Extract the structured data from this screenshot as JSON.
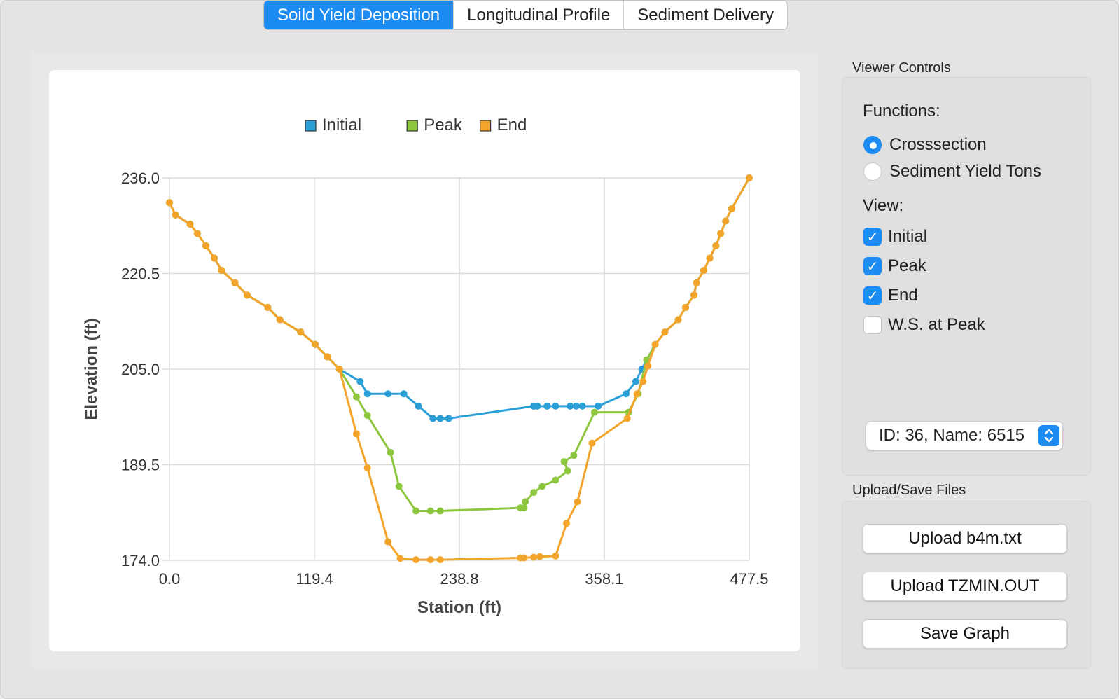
{
  "tabs": [
    {
      "label": "Soild Yield Deposition",
      "active": true
    },
    {
      "label": "Longitudinal Profile",
      "active": false
    },
    {
      "label": "Sediment Delivery",
      "active": false
    }
  ],
  "chart_data": {
    "type": "line",
    "xlabel": "Station (ft)",
    "ylabel": "Elevation (ft)",
    "xlim": [
      0.0,
      477.5
    ],
    "ylim": [
      174.0,
      236.0
    ],
    "xticks": [
      "0.0",
      "119.4",
      "238.8",
      "358.1",
      "477.5"
    ],
    "yticks": [
      "174.0",
      "189.5",
      "205.0",
      "220.5",
      "236.0"
    ],
    "grid": true,
    "legend_position": "top-center",
    "series": [
      {
        "name": "Initial",
        "color": "#2a9fd8",
        "points": [
          [
            0,
            232
          ],
          [
            5,
            230
          ],
          [
            17,
            228.5
          ],
          [
            23,
            227
          ],
          [
            30,
            225
          ],
          [
            37,
            223
          ],
          [
            43,
            221
          ],
          [
            54,
            219
          ],
          [
            64,
            217
          ],
          [
            81,
            215
          ],
          [
            91,
            213
          ],
          [
            108,
            211
          ],
          [
            120,
            209
          ],
          [
            130,
            207
          ],
          [
            140,
            205
          ],
          [
            157,
            203
          ],
          [
            163,
            201
          ],
          [
            180,
            201
          ],
          [
            193,
            201
          ],
          [
            205,
            199
          ],
          [
            217,
            197
          ],
          [
            223,
            197
          ],
          [
            230,
            197
          ],
          [
            300,
            199
          ],
          [
            303,
            199
          ],
          [
            300,
            199
          ],
          [
            311,
            199
          ],
          [
            318,
            199
          ],
          [
            330,
            199
          ],
          [
            335,
            199
          ],
          [
            340,
            199
          ],
          [
            353,
            199
          ],
          [
            376,
            201
          ],
          [
            384,
            203
          ],
          [
            389,
            205
          ],
          [
            393,
            206.5
          ],
          [
            400,
            209
          ],
          [
            408,
            211
          ],
          [
            419,
            213
          ],
          [
            425,
            215
          ],
          [
            432,
            217
          ],
          [
            434,
            219
          ],
          [
            440,
            221
          ],
          [
            445,
            223
          ],
          [
            450,
            225
          ],
          [
            454,
            227
          ],
          [
            458,
            229
          ],
          [
            463,
            231
          ],
          [
            477.5,
            236
          ]
        ]
      },
      {
        "name": "Peak",
        "color": "#8dc63f",
        "points": [
          [
            0,
            232
          ],
          [
            5,
            230
          ],
          [
            17,
            228.5
          ],
          [
            23,
            227
          ],
          [
            30,
            225
          ],
          [
            37,
            223
          ],
          [
            43,
            221
          ],
          [
            54,
            219
          ],
          [
            64,
            217
          ],
          [
            81,
            215
          ],
          [
            91,
            213
          ],
          [
            108,
            211
          ],
          [
            120,
            209
          ],
          [
            130,
            207
          ],
          [
            140,
            205
          ],
          [
            154,
            200.5
          ],
          [
            163,
            197.5
          ],
          [
            182,
            191.5
          ],
          [
            189,
            186
          ],
          [
            203,
            182
          ],
          [
            215,
            182
          ],
          [
            223,
            182
          ],
          [
            289,
            182.5
          ],
          [
            292,
            182.5
          ],
          [
            293,
            183.5
          ],
          [
            300,
            185
          ],
          [
            307,
            186
          ],
          [
            318,
            187
          ],
          [
            328,
            188.5
          ],
          [
            325,
            190
          ],
          [
            333,
            191
          ],
          [
            350,
            198
          ],
          [
            378,
            198
          ],
          [
            386,
            201
          ],
          [
            393,
            206.5
          ],
          [
            400,
            209
          ],
          [
            408,
            211
          ],
          [
            419,
            213
          ],
          [
            425,
            215
          ],
          [
            432,
            217
          ],
          [
            434,
            219
          ],
          [
            440,
            221
          ],
          [
            445,
            223
          ],
          [
            450,
            225
          ],
          [
            454,
            227
          ],
          [
            458,
            229
          ],
          [
            463,
            231
          ],
          [
            477.5,
            236
          ]
        ]
      },
      {
        "name": "End",
        "color": "#f3a42a",
        "points": [
          [
            0,
            232
          ],
          [
            5,
            230
          ],
          [
            17,
            228.5
          ],
          [
            23,
            227
          ],
          [
            30,
            225
          ],
          [
            37,
            223
          ],
          [
            43,
            221
          ],
          [
            54,
            219
          ],
          [
            64,
            217
          ],
          [
            81,
            215
          ],
          [
            91,
            213
          ],
          [
            108,
            211
          ],
          [
            120,
            209
          ],
          [
            130,
            207
          ],
          [
            140,
            205
          ],
          [
            154,
            194.5
          ],
          [
            163,
            189
          ],
          [
            180,
            177
          ],
          [
            190,
            174.3
          ],
          [
            203,
            174.1
          ],
          [
            215,
            174.1
          ],
          [
            223,
            174.1
          ],
          [
            289,
            174.4
          ],
          [
            292,
            174.4
          ],
          [
            300,
            174.5
          ],
          [
            305,
            174.6
          ],
          [
            318,
            174.7
          ],
          [
            327,
            180
          ],
          [
            336,
            183.5
          ],
          [
            348,
            193
          ],
          [
            377,
            197
          ],
          [
            385,
            201
          ],
          [
            390,
            203
          ],
          [
            394,
            205.5
          ],
          [
            400,
            209
          ],
          [
            408,
            211
          ],
          [
            419,
            213
          ],
          [
            425,
            215
          ],
          [
            432,
            217
          ],
          [
            434,
            219
          ],
          [
            440,
            221
          ],
          [
            445,
            223
          ],
          [
            450,
            225
          ],
          [
            454,
            227
          ],
          [
            458,
            229
          ],
          [
            463,
            231
          ],
          [
            477.5,
            236
          ]
        ]
      }
    ]
  },
  "viewer_controls": {
    "title": "Viewer Controls",
    "functions_label": "Functions:",
    "functions": [
      {
        "label": "Crosssection",
        "selected": true
      },
      {
        "label": "Sediment Yield Tons",
        "selected": false
      }
    ],
    "view_label": "View:",
    "view_options": [
      {
        "label": "Initial",
        "checked": true
      },
      {
        "label": "Peak",
        "checked": true
      },
      {
        "label": "End",
        "checked": true
      },
      {
        "label": "W.S. at Peak",
        "checked": false
      }
    ],
    "selector_value": "ID: 36, Name: 6515"
  },
  "upload_save": {
    "title": "Upload/Save Files",
    "buttons": [
      "Upload b4m.txt",
      "Upload TZMIN.OUT",
      "Save Graph"
    ]
  }
}
